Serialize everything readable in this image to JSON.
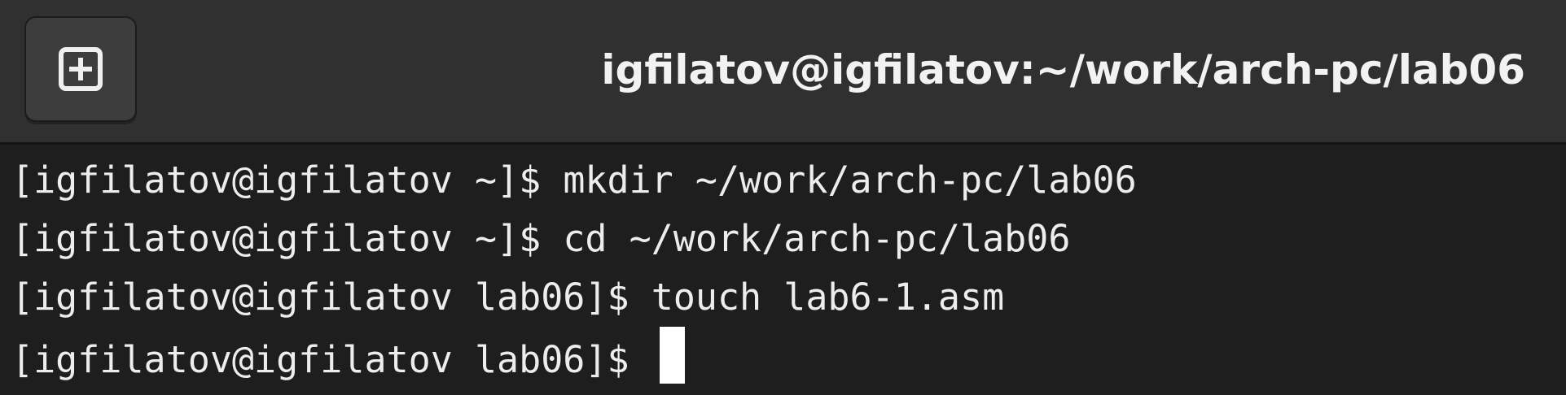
{
  "window": {
    "title": "igfilatov@igfilatov:~/work/arch-pc/lab06",
    "new_tab_icon": "plus-box-icon"
  },
  "terminal": {
    "lines": [
      {
        "prompt": "[igfilatov@igfilatov ~]$ ",
        "command": "mkdir ~/work/arch-pc/lab06"
      },
      {
        "prompt": "[igfilatov@igfilatov ~]$ ",
        "command": "cd ~/work/arch-pc/lab06"
      },
      {
        "prompt": "[igfilatov@igfilatov lab06]$ ",
        "command": "touch lab6-1.asm"
      },
      {
        "prompt": "[igfilatov@igfilatov lab06]$ ",
        "command": ""
      }
    ]
  },
  "colors": {
    "titlebar_bg": "#303030",
    "terminal_bg": "#1e1e1e",
    "text": "#ededed",
    "cursor": "#ffffff"
  }
}
